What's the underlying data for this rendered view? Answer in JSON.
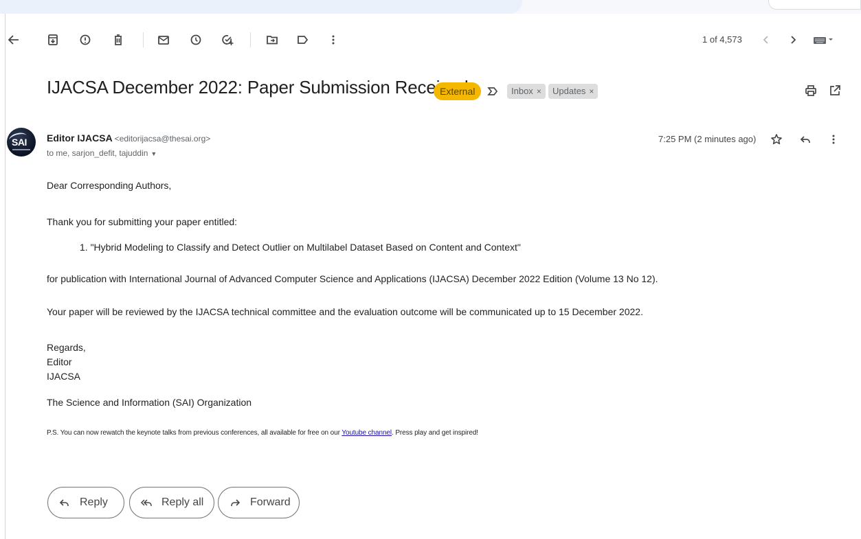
{
  "toolbar": {
    "icons": [
      "back-arrow-icon",
      "archive-icon",
      "report-spam-icon",
      "delete-icon",
      "mark-unread-icon",
      "snooze-icon",
      "add-to-tasks-icon",
      "move-to-icon",
      "label-icon",
      "more-vert-icon"
    ],
    "pager_text": "1 of 4,573"
  },
  "message": {
    "subject": "IJACSA December 2022: Paper Submission Received",
    "badge": "External",
    "labels": [
      {
        "name": "Inbox",
        "remove": "×"
      },
      {
        "name": "Updates",
        "remove": "×"
      }
    ],
    "sender_name": "Editor IJACSA",
    "sender_email": "<editorijacsa@thesai.org>",
    "recipients": "to me, sarjon_defit, tajuddin",
    "recipients_caret": "▼",
    "timestamp": "7:25 PM (2 minutes ago)",
    "avatar_text": "SAI"
  },
  "body": {
    "greeting": "Dear Corresponding Authors,",
    "intro": "Thank you for submitting your paper entitled:",
    "paper_item": "1. \"Hybrid Modeling to Classify and Detect Outlier on Multilabel Dataset Based on Content and Context\"",
    "publication": "for publication with International Journal of Advanced Computer Science and Applications (IJACSA) December 2022 Edition (Volume 13 No 12).",
    "review": "Your paper will be reviewed by the IJACSA technical committee and the evaluation outcome will be communicated up to 15 December 2022.",
    "signoff": [
      "Regards,",
      "Editor",
      "IJACSA",
      "The Science and Information (SAI) Organization"
    ],
    "ps_before": "P.S. You can now rewatch the keynote talks from previous conferences, all available for free on our ",
    "ps_link": "Youtube channel",
    "ps_after": ". Press play and get inspired!"
  },
  "actions": {
    "reply": "Reply",
    "reply_all": "Reply all",
    "forward": "Forward"
  },
  "colors": {
    "badge_bg": "#f5b800",
    "chip_bg": "#dddddd",
    "link": "#1a0dab"
  }
}
